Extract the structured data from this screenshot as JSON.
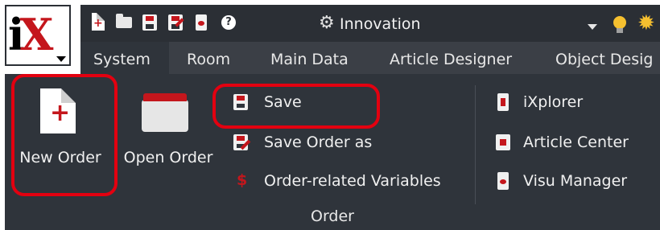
{
  "quick_access": {
    "workspace_label": "Innovation",
    "icons": [
      "new-order-icon",
      "open-folder-icon",
      "save-icon",
      "save-as-icon",
      "clipboard-icon",
      "help-icon",
      "gear-icon"
    ]
  },
  "tabs": [
    {
      "label": "System",
      "active": true
    },
    {
      "label": "Room",
      "active": false
    },
    {
      "label": "Main Data",
      "active": false
    },
    {
      "label": "Article Designer",
      "active": false
    },
    {
      "label": "Object Desig",
      "active": false
    }
  ],
  "ribbon": {
    "new_order_label": "New Order",
    "open_order_label": "Open Order",
    "save_label": "Save",
    "save_as_label": "Save Order as",
    "variables_label": "Order-related Variables",
    "ixplorer_label": "iXplorer",
    "article_center_label": "Article Center",
    "visu_manager_label": "Visu Manager",
    "group_label": "Order"
  },
  "colors": {
    "brand_red": "#c4161c",
    "highlight_red": "#e30010",
    "ribbon_bg": "#2f343b",
    "title_bg": "#2b2f35"
  }
}
